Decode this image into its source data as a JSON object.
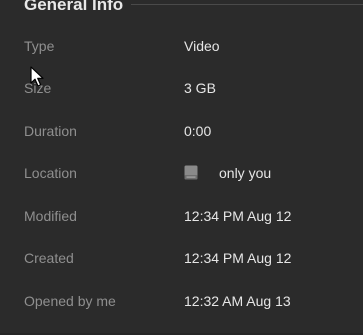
{
  "section": {
    "title": "General Info"
  },
  "rows": [
    {
      "label": "Type",
      "value": "Video"
    },
    {
      "label": "Size",
      "value": "3 GB"
    },
    {
      "label": "Duration",
      "value": "0:00"
    },
    {
      "label": "Location",
      "value": "only you",
      "icon": "storage-icon"
    },
    {
      "label": "Modified",
      "value": "12:34 PM Aug 12"
    },
    {
      "label": "Created",
      "value": "12:34 PM Aug 12"
    },
    {
      "label": "Opened by me",
      "value": "12:32 AM Aug 13"
    }
  ],
  "colors": {
    "background": "#2b2b2b",
    "label": "#8f8f8f",
    "value": "#e6e6e6",
    "title": "#e8e8e8"
  }
}
